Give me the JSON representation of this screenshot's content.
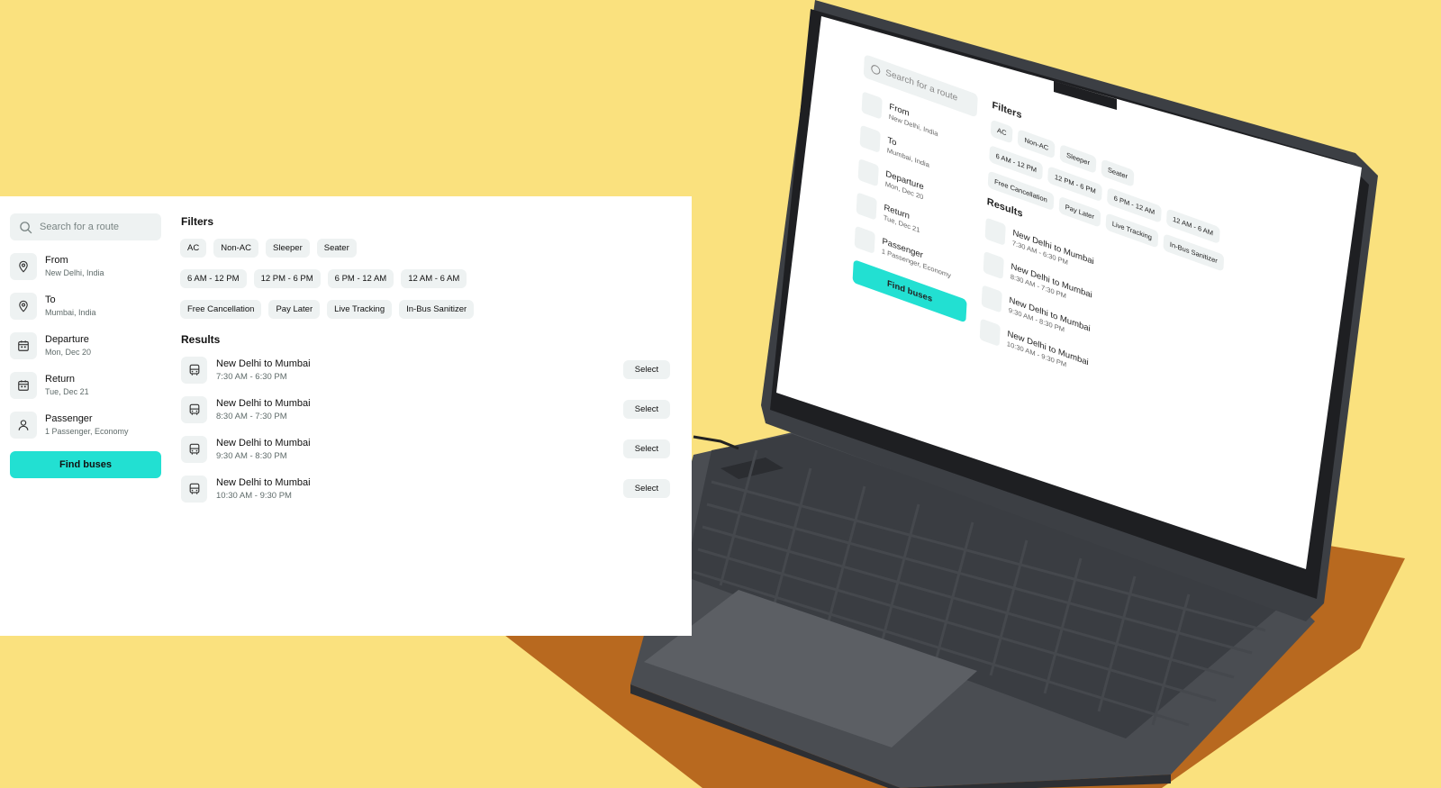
{
  "search": {
    "placeholder": "Search for a route"
  },
  "sidebar": {
    "items": [
      {
        "title": "From",
        "subtitle": "New Delhi, India",
        "icon": "location-pin-icon"
      },
      {
        "title": "To",
        "subtitle": "Mumbai, India",
        "icon": "location-pin-icon"
      },
      {
        "title": "Departure",
        "subtitle": "Mon, Dec 20",
        "icon": "calendar-icon"
      },
      {
        "title": "Return",
        "subtitle": "Tue, Dec 21",
        "icon": "calendar-icon"
      },
      {
        "title": "Passenger",
        "subtitle": "1 Passenger, Economy",
        "icon": "user-icon"
      }
    ],
    "find_label": "Find buses"
  },
  "filters": {
    "title": "Filters",
    "bus_type": [
      "AC",
      "Non-AC",
      "Sleeper",
      "Seater"
    ],
    "time": [
      "6 AM - 12 PM",
      "12 PM - 6 PM",
      "6 PM - 12 AM",
      "12 AM - 6 AM"
    ],
    "features": [
      "Free Cancellation",
      "Pay Later",
      "Live Tracking",
      "In-Bus Sanitizer"
    ]
  },
  "results": {
    "title": "Results",
    "select_label": "Select",
    "items": [
      {
        "route": "New Delhi to Mumbai",
        "time": "7:30 AM - 6:30 PM"
      },
      {
        "route": "New Delhi to Mumbai",
        "time": "8:30 AM - 7:30 PM"
      },
      {
        "route": "New Delhi to Mumbai",
        "time": "9:30 AM - 8:30 PM"
      },
      {
        "route": "New Delhi to Mumbai",
        "time": "10:30 AM - 9:30 PM"
      }
    ]
  },
  "colors": {
    "background": "#fae17e",
    "accent": "#22e0d2",
    "chip": "#eef2f2",
    "laptop_body": "#3c3f44",
    "shadow": "#b8691f"
  }
}
